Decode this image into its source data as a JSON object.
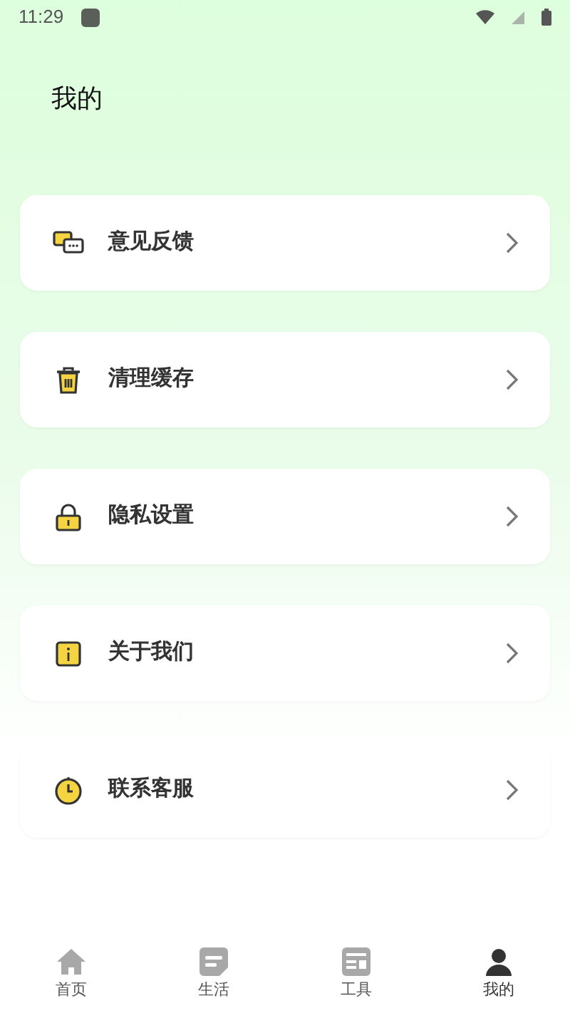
{
  "status_bar": {
    "time": "11:29"
  },
  "header": {
    "title": "我的"
  },
  "menu": [
    {
      "kind": "feedback",
      "label": "意见反馈"
    },
    {
      "kind": "cache",
      "label": "清理缓存"
    },
    {
      "kind": "privacy",
      "label": "隐私设置"
    },
    {
      "kind": "about",
      "label": "关于我们"
    },
    {
      "kind": "service",
      "label": "联系客服"
    }
  ],
  "tab_bar": [
    {
      "kind": "home",
      "label": "首页",
      "selected": false
    },
    {
      "kind": "life",
      "label": "生活",
      "selected": false
    },
    {
      "kind": "tools",
      "label": "工具",
      "selected": false
    },
    {
      "kind": "mine",
      "label": "我的",
      "selected": true
    }
  ]
}
